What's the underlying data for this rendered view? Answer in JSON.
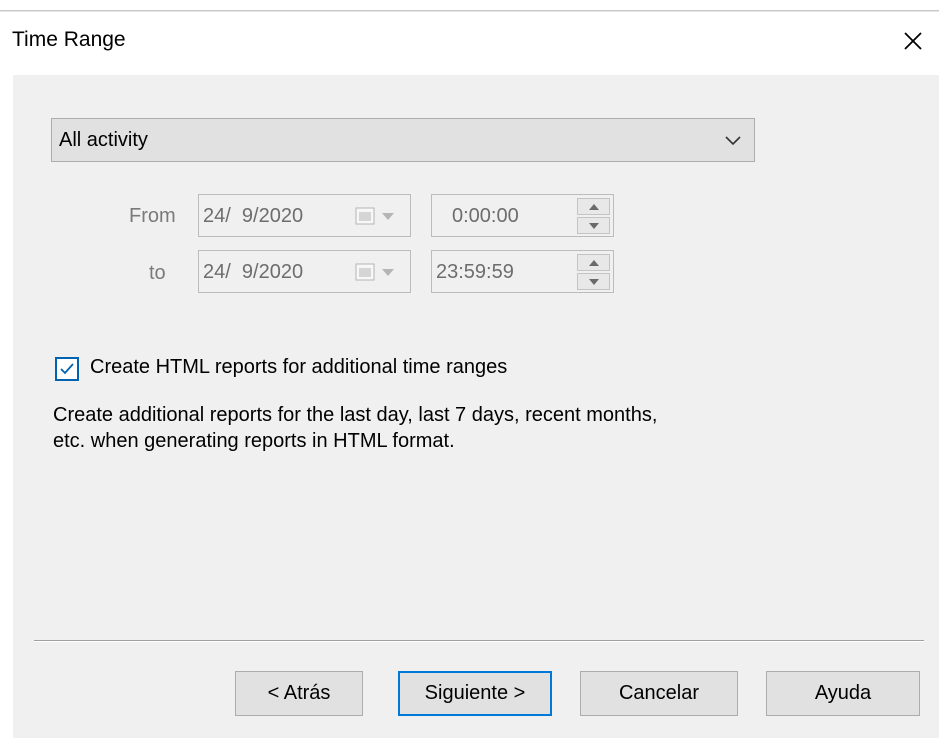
{
  "dialog": {
    "title": "Time Range",
    "close_icon": "close-icon"
  },
  "range_select": {
    "selected": "All activity",
    "icon": "chevron-down-icon"
  },
  "from": {
    "label": "From",
    "date": "24/  9/2020",
    "time": "0:00:00"
  },
  "to": {
    "label": "to",
    "date": "24/  9/2020",
    "time": "23:59:59"
  },
  "html_reports": {
    "checked": true,
    "label": "Create HTML reports for additional time ranges",
    "description_line1": "Create additional reports for the last day, last 7 days, recent months,",
    "description_line2": "etc. when generating reports in HTML format."
  },
  "buttons": {
    "back": "< Atrás",
    "next": "Siguiente >",
    "cancel": "Cancelar",
    "help": "Ayuda"
  },
  "colors": {
    "accent": "#0078d7",
    "panel_bg": "#f0f0f0",
    "disabled_text": "#7a7a7a"
  }
}
